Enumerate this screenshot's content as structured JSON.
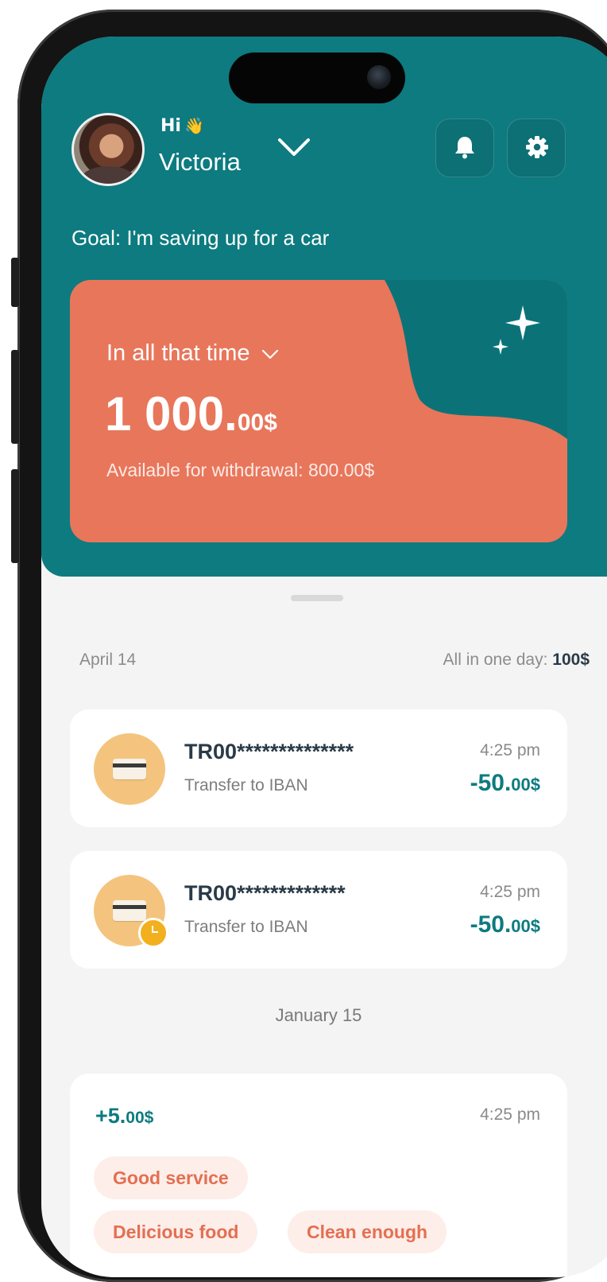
{
  "header": {
    "greeting": "Hi",
    "greeting_emoji": "👋",
    "user_name": "Victoria",
    "goal": "Goal: I'm saving up for a car"
  },
  "balance_card": {
    "period_label": "In all that time",
    "amount_main": "1 000.",
    "amount_cents": "00$",
    "available": "Available for withdrawal: 800.00$"
  },
  "sections": [
    {
      "date": "April 14",
      "total_label": "All in one day: ",
      "total_value": "100$",
      "transactions": [
        {
          "title": "TR00**************",
          "subtitle": "Transfer to IBAN",
          "time": "4:25 pm",
          "amount_main": "-50.",
          "amount_cents": "00$",
          "pending": false
        },
        {
          "title": "TR00*************",
          "subtitle": "Transfer to IBAN",
          "time": "4:25 pm",
          "amount_main": "-50.",
          "amount_cents": "00$",
          "pending": true
        }
      ]
    },
    {
      "date": "January 15",
      "review": {
        "amount_main": "+5.",
        "amount_cents": "00$",
        "time": "4:25 pm",
        "tags": [
          "Good service",
          "Delicious food",
          "Clean enough"
        ]
      }
    }
  ],
  "colors": {
    "teal": "#0d7b80",
    "coral": "#e8765b",
    "background": "#f4f4f4",
    "icon_yellow": "#f4c47e"
  },
  "icons": [
    "bell-icon",
    "gear-icon",
    "chevron-down-icon",
    "sparkle-icon",
    "credit-card-icon",
    "clock-icon"
  ]
}
